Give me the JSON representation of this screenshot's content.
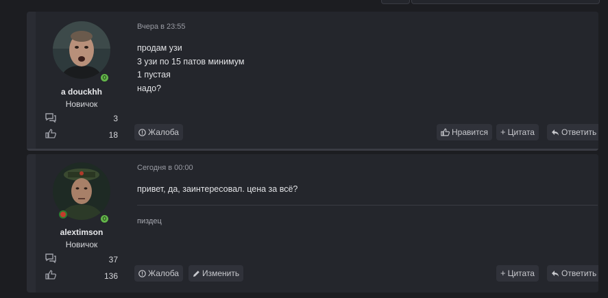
{
  "posts": [
    {
      "date": "Вчера в 23:55",
      "user": {
        "name": "a douckhh",
        "title": "Новичок",
        "messages": "3",
        "reactions": "18"
      },
      "message_lines": [
        "продам узи",
        "3 узи по 15 патов минимум",
        "1 пустая",
        "надо?"
      ],
      "signature": "",
      "actions_left": [
        {
          "label": "Жалоба"
        }
      ],
      "actions_right": [
        {
          "label": "Нравится"
        },
        {
          "label": "Цитата"
        },
        {
          "label": "Ответить"
        }
      ]
    },
    {
      "date": "Сегодня в 00:00",
      "user": {
        "name": "alextimson",
        "title": "Новичок",
        "messages": "37",
        "reactions": "136"
      },
      "message_lines": [
        "привет, да, заинтересовал. цена за всё?"
      ],
      "signature": "пиздец",
      "actions_left": [
        {
          "label": "Жалоба"
        },
        {
          "label": "Изменить"
        }
      ],
      "actions_right": [
        {
          "label": "Цитата"
        },
        {
          "label": "Ответить"
        }
      ]
    }
  ],
  "colors": {
    "online": "#63b54a",
    "panel": "#24262c",
    "button": "#30323a"
  }
}
